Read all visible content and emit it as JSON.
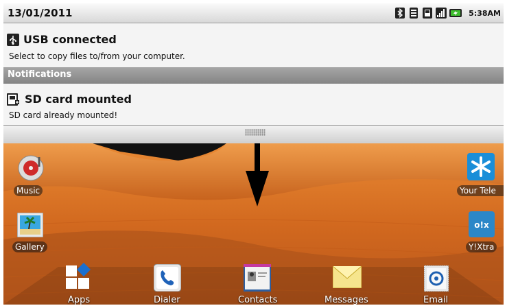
{
  "status_bar": {
    "date": "13/01/2011",
    "time": "5:38AM",
    "icons": [
      "bluetooth-icon",
      "signal-icon",
      "sd-card-icon",
      "bars-icon",
      "battery-icon"
    ]
  },
  "notifications": {
    "usb": {
      "title": "USB connected",
      "text": "Select to copy files to/from your computer.",
      "icon": "usb-icon"
    },
    "section_label": "Notifications",
    "sdcard": {
      "title": "SD card mounted",
      "text": "SD card already mounted!",
      "icon": "sd-card-mounted-icon"
    }
  },
  "home": {
    "left_apps": [
      {
        "label": "Music",
        "icon": "music-icon"
      },
      {
        "label": "Gallery",
        "icon": "gallery-icon"
      }
    ],
    "right_apps": [
      {
        "label": "Your Tele",
        "icon": "your-telecom-icon"
      },
      {
        "label": "Y!Xtra",
        "icon": "yahoo-xtra-icon",
        "badge": "o!x"
      }
    ],
    "dock": [
      {
        "label": "Apps",
        "icon": "apps-grid-icon"
      },
      {
        "label": "Dialer",
        "icon": "phone-icon"
      },
      {
        "label": "Contacts",
        "icon": "contacts-card-icon"
      },
      {
        "label": "Messages",
        "icon": "envelope-icon"
      },
      {
        "label": "Email",
        "icon": "email-at-icon"
      }
    ]
  },
  "colors": {
    "wallpaper_orange": "#d0681c",
    "statusbar": "#e0e0e0",
    "section_bar": "#959595"
  }
}
